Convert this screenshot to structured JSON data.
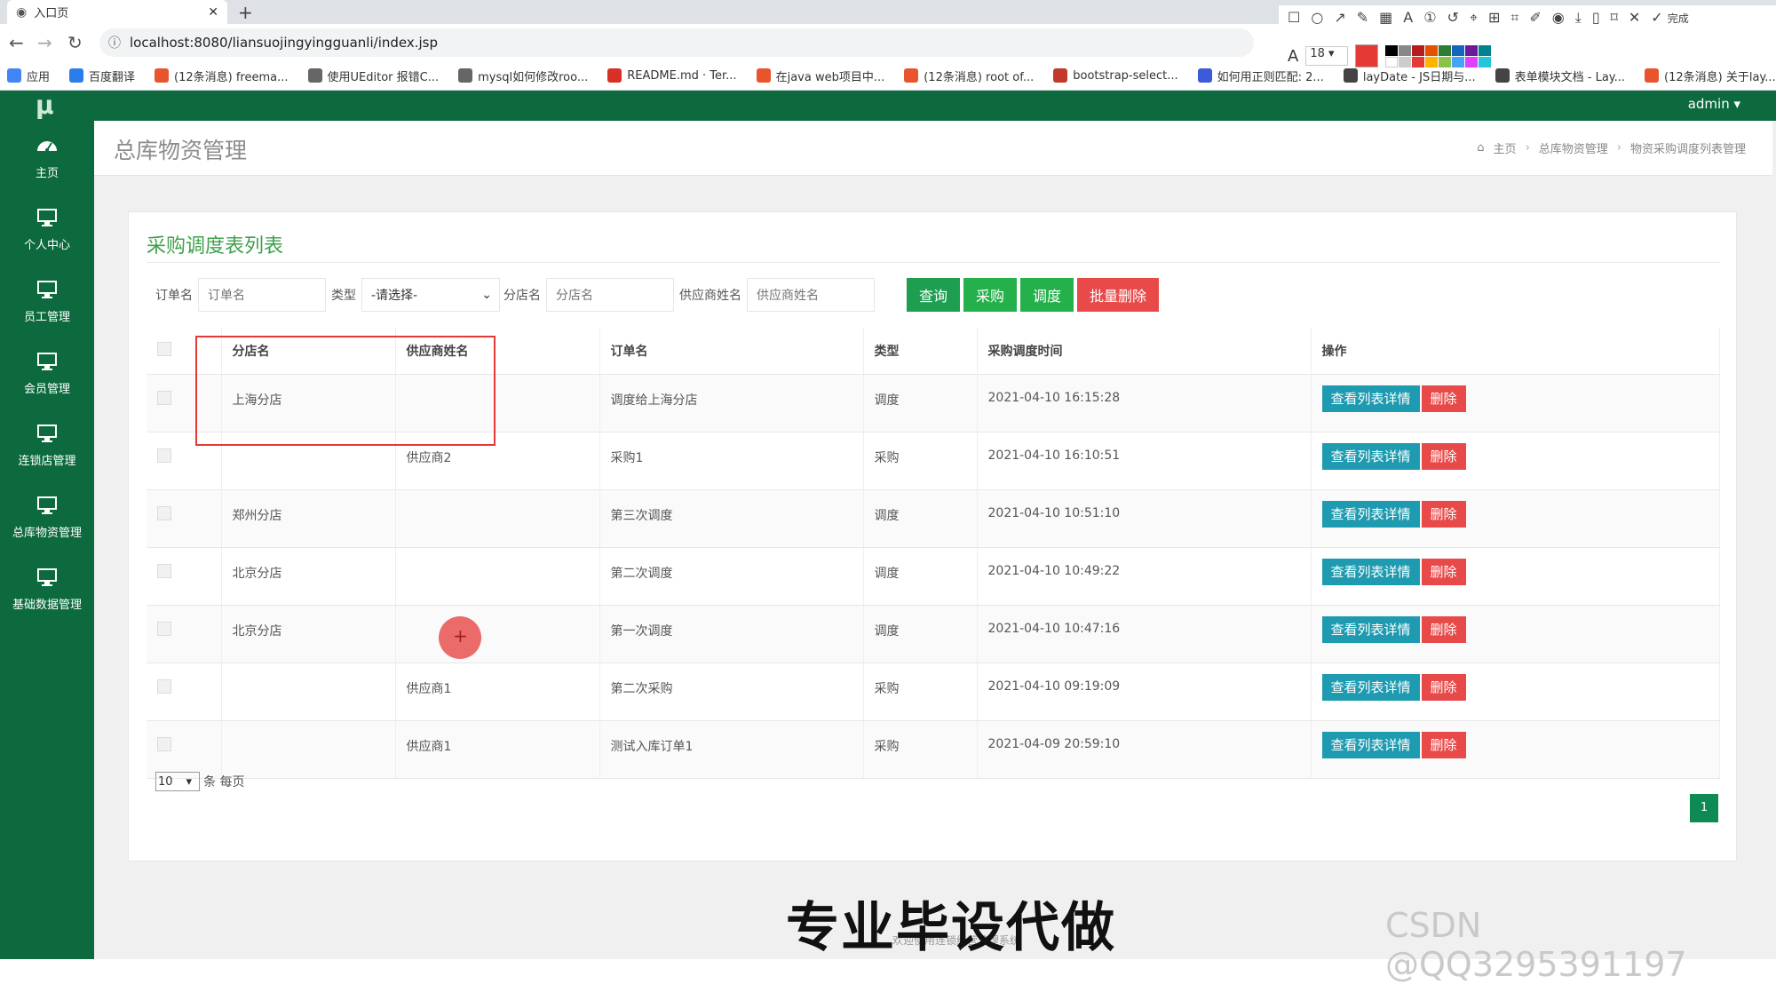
{
  "browser": {
    "tab_title": "入口页",
    "url": "localhost:8080/liansuojingyingguanli/index.jsp",
    "bookmarks": [
      {
        "label": "应用",
        "color": "#4285f4"
      },
      {
        "label": "百度翻译",
        "color": "#2b7de9"
      },
      {
        "label": "(12条消息) freema...",
        "color": "#e8542e"
      },
      {
        "label": "使用UEditor 报错C...",
        "color": "#666666"
      },
      {
        "label": "mysql如何修改roo...",
        "color": "#666666"
      },
      {
        "label": "README.md · Ter...",
        "color": "#d93025"
      },
      {
        "label": "在java web项目中...",
        "color": "#e8542e"
      },
      {
        "label": "(12条消息) root of...",
        "color": "#e8542e"
      },
      {
        "label": "bootstrap-select...",
        "color": "#c0392b"
      },
      {
        "label": "如何用正则匹配: 2...",
        "color": "#3b5bdb"
      },
      {
        "label": "layDate - JS日期与...",
        "color": "#444444"
      },
      {
        "label": "表单模块文档 - Lay...",
        "color": "#444444"
      },
      {
        "label": "(12条消息) 关于lay...",
        "color": "#e8542e"
      }
    ],
    "annotation_size": "18",
    "done_label": "完成"
  },
  "app": {
    "logo": "μ",
    "user": "admin ▾",
    "sidebar": [
      {
        "label": "主页",
        "icon": "dashboard-icon"
      },
      {
        "label": "个人中心",
        "icon": "monitor-icon"
      },
      {
        "label": "员工管理",
        "icon": "monitor-icon"
      },
      {
        "label": "会员管理",
        "icon": "monitor-icon"
      },
      {
        "label": "连锁店管理",
        "icon": "monitor-icon"
      },
      {
        "label": "总库物资管理",
        "icon": "monitor-icon"
      },
      {
        "label": "基础数据管理",
        "icon": "monitor-icon"
      }
    ],
    "page_title": "总库物资管理",
    "breadcrumb": {
      "home": "主页",
      "level1": "总库物资管理",
      "level2": "物资采购调度列表管理"
    }
  },
  "card": {
    "title": "采购调度表列表",
    "filters": {
      "order_label": "订单名",
      "order_placeholder": "订单名",
      "type_label": "类型",
      "type_value": "-请选择-",
      "branch_label": "分店名",
      "branch_placeholder": "分店名",
      "supplier_label": "供应商姓名",
      "supplier_placeholder": "供应商姓名"
    },
    "buttons": {
      "query": "查询",
      "purchase": "采购",
      "dispatch": "调度",
      "batch_delete": "批量删除"
    },
    "columns": [
      "分店名",
      "供应商姓名",
      "订单名",
      "类型",
      "采购调度时间",
      "操作"
    ],
    "rows": [
      {
        "branch": "上海分店",
        "supplier": "",
        "order": "调度给上海分店",
        "type": "调度",
        "time": "2021-04-10 16:15:28"
      },
      {
        "branch": "",
        "supplier": "供应商2",
        "order": "采购1",
        "type": "采购",
        "time": "2021-04-10 16:10:51"
      },
      {
        "branch": "郑州分店",
        "supplier": "",
        "order": "第三次调度",
        "type": "调度",
        "time": "2021-04-10 10:51:10"
      },
      {
        "branch": "北京分店",
        "supplier": "",
        "order": "第二次调度",
        "type": "调度",
        "time": "2021-04-10 10:49:22"
      },
      {
        "branch": "北京分店",
        "supplier": "",
        "order": "第一次调度",
        "type": "调度",
        "time": "2021-04-10 10:47:16"
      },
      {
        "branch": "",
        "supplier": "供应商1",
        "order": "第二次采购",
        "type": "采购",
        "time": "2021-04-10 09:19:09"
      },
      {
        "branch": "",
        "supplier": "供应商1",
        "order": "测试入库订单1",
        "type": "采购",
        "time": "2021-04-09 20:59:10"
      }
    ],
    "row_actions": {
      "detail": "查看列表详情",
      "delete": "删除"
    },
    "pager": {
      "size": "10",
      "suffix": "条 每页",
      "current_page": "1"
    }
  },
  "watermarks": {
    "big": "专业毕设代做",
    "csdn": "CSDN @QQ3295391197",
    "footer": "欢迎使用连锁经营管理系统"
  }
}
